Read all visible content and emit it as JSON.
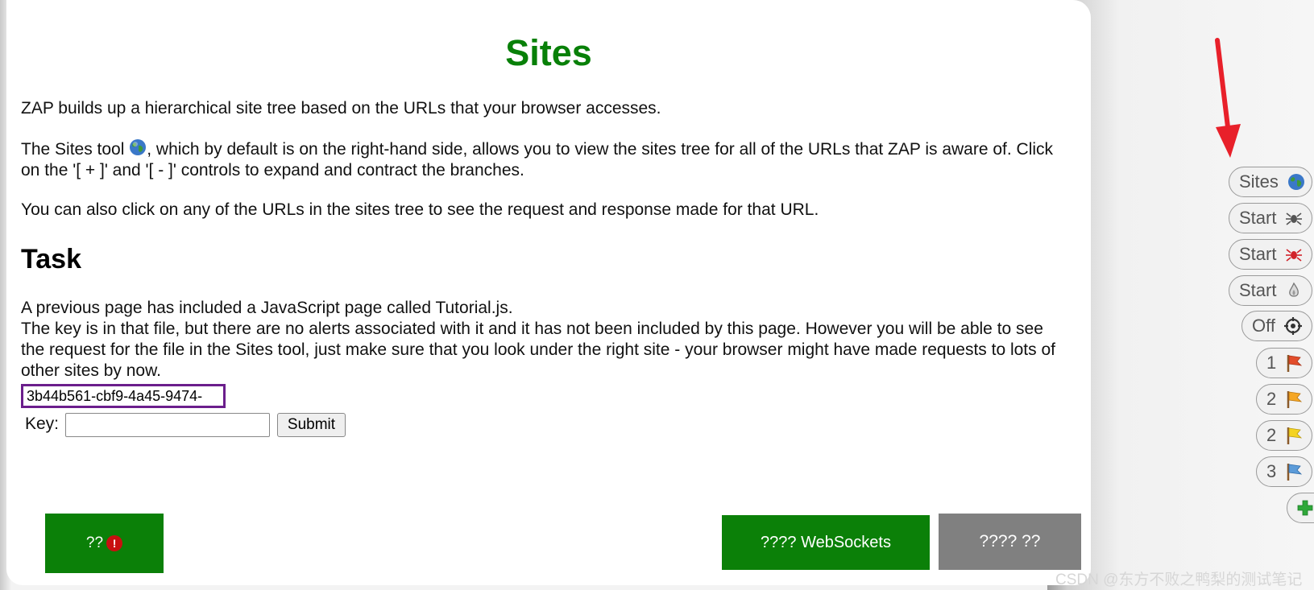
{
  "page": {
    "title": "Sites",
    "intro": "ZAP builds up a hierarchical site tree based on the URLs that your browser accesses.",
    "sites_tool_before": "The Sites tool ",
    "sites_tool_after": ", which by default is on the right-hand side, allows you to view the sites tree for all of the URLs that ZAP is aware of. Click on the '[ + ]' and '[ - ]' controls to expand and contract the branches.",
    "click_urls": "You can also click on any of the URLs in the sites tree to see the request and response made for that URL.",
    "task_heading": "Task",
    "task_line1": "A previous page has included a JavaScript page called Tutorial.js.",
    "task_line2": "The key is in that file, but there are no alerts associated with it and it has not been included by this page. However you will be able to see the request for the file in the Sites tool, just make sure that you look under the right site - your browser might have made requests to lots of other sites by now."
  },
  "key_form": {
    "revealed_key": "3b44b561-cbf9-4a45-9474-",
    "key_label": "Key:",
    "key_value": "",
    "submit_label": "Submit"
  },
  "bottom_buttons": {
    "alerts_label": "??",
    "alerts_icon_glyph": "!",
    "websockets_label": "???? WebSockets",
    "grey_label": "???? ??"
  },
  "toolbar": {
    "items": [
      {
        "label": "Sites",
        "icon": "globe-icon"
      },
      {
        "label": "Start",
        "icon": "spider-icon"
      },
      {
        "label": "Start",
        "icon": "ajax-spider-icon"
      },
      {
        "label": "Start",
        "icon": "active-scan-icon"
      },
      {
        "label": "Off",
        "icon": "break-target-icon"
      },
      {
        "label": "1",
        "icon": "red-flag-icon"
      },
      {
        "label": "2",
        "icon": "orange-flag-icon"
      },
      {
        "label": "2",
        "icon": "yellow-flag-icon"
      },
      {
        "label": "3",
        "icon": "blue-flag-icon"
      },
      {
        "label": "",
        "icon": "plus-icon"
      }
    ]
  },
  "colors": {
    "title_green": "#088008",
    "button_green": "#0b8008",
    "grey_button": "#808080",
    "key_border": "#6b1e8c",
    "arrow_red": "#e8202a"
  },
  "watermark": "CSDN @东方不败之鸭梨的测试笔记"
}
